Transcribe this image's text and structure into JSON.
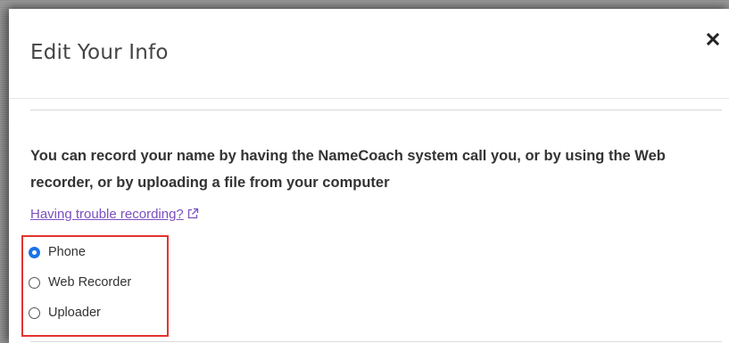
{
  "modal": {
    "title": "Edit Your Info",
    "close_icon": "close-icon"
  },
  "content": {
    "instructions": "You can record your name by having the NameCoach system call you, or by using the Web recorder, or by uploading a file from your computer",
    "trouble_link": "Having trouble recording?",
    "trouble_link_icon": "external-link-icon"
  },
  "recording_method": {
    "options": [
      {
        "label": "Phone",
        "checked": true
      },
      {
        "label": "Web Recorder",
        "checked": false
      },
      {
        "label": "Uploader",
        "checked": false
      }
    ],
    "highlight_color": "#e3342f"
  },
  "colors": {
    "link": "#7b4fc0",
    "radio_selected": "#1a73e8"
  }
}
